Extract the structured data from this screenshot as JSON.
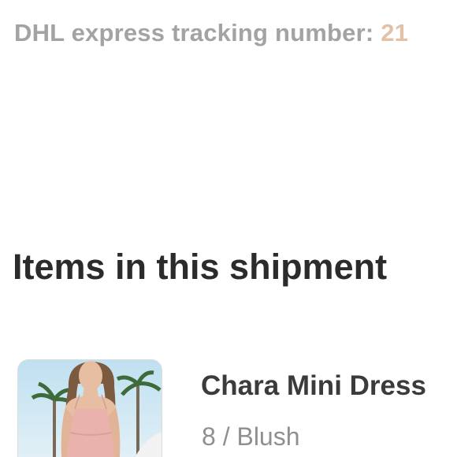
{
  "shipment": {
    "tracking_label": "DHL express tracking number:",
    "tracking_number": "21"
  },
  "items_section": {
    "heading": "Items in this shipment"
  },
  "items": [
    {
      "name": "Chara Mini Dress",
      "variant": "8 / Blush"
    }
  ],
  "colors": {
    "tracking_number": "#e2c2a7",
    "heading": "#2b2b2b",
    "muted_text": "#8f8f8f"
  }
}
